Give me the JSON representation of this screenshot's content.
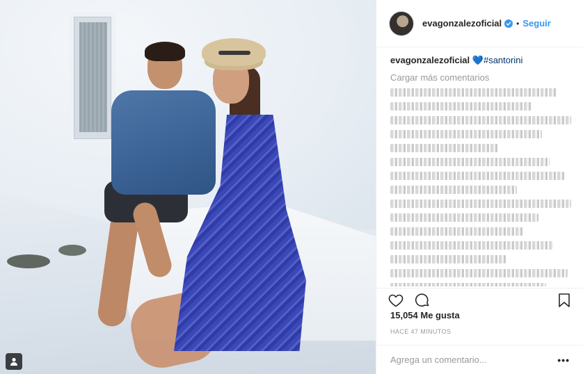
{
  "post": {
    "username": "evagonzalezoficial",
    "follow_label": "Seguir",
    "dot": "•"
  },
  "caption": {
    "username": "evagonzalezoficial",
    "heart": "💙",
    "hashtag": "#santorini"
  },
  "comments": {
    "load_more": "Cargar más comentarios",
    "blurred_line_count": 18
  },
  "likes_label": "15,054 Me gusta",
  "timestamp": "HACE 47 MINUTOS",
  "add_comment_placeholder": "Agrega un comentario...",
  "more_icon_label": "•••",
  "colors": {
    "accent": "#3897f0",
    "text": "#262626",
    "muted": "#999999"
  },
  "icons": {
    "verified": "verified-badge-icon",
    "like": "heart-outline-icon",
    "comment": "comment-bubble-icon",
    "save": "bookmark-icon",
    "tagged": "user-tag-icon"
  }
}
